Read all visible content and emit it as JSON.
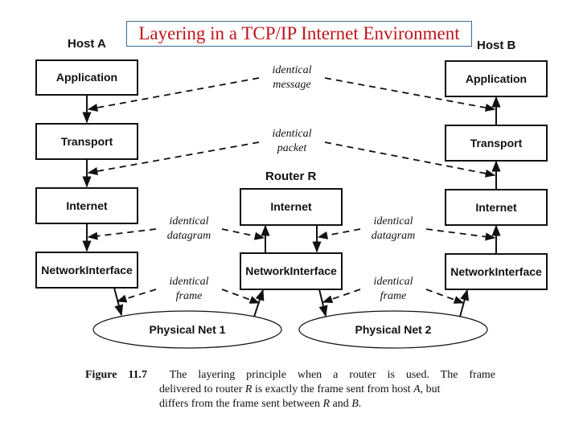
{
  "title": "Layering in a TCP/IP Internet Environment",
  "hosts": {
    "a": {
      "label": "Host A",
      "layers": [
        "Application",
        "Transport",
        "Internet",
        "Network Interface"
      ]
    },
    "router": {
      "label": "Router R",
      "layers": [
        "Internet",
        "Network Interface"
      ]
    },
    "b": {
      "label": "Host B",
      "layers": [
        "Application",
        "Transport",
        "Internet",
        "Network Interface"
      ]
    }
  },
  "annotations": {
    "message": [
      "identical",
      "message"
    ],
    "packet": [
      "identical",
      "packet"
    ],
    "datagram_left": [
      "identical",
      "datagram"
    ],
    "datagram_right": [
      "identical",
      "datagram"
    ],
    "frame_left": [
      "identical",
      "frame"
    ],
    "frame_right": [
      "identical",
      "frame"
    ]
  },
  "networks": [
    "Physical Net 1",
    "Physical Net 2"
  ],
  "caption": {
    "figure": "Figure 11.7",
    "line1": "The layering principle when a router is used. The frame",
    "line2_a": "delivered to router ",
    "line2_r": "R",
    "line2_b": " is exactly the frame sent from host ",
    "line2_h": "A",
    "line2_c": ", but",
    "line3_a": "differs from the frame sent between ",
    "line3_r": "R",
    "line3_b": " and ",
    "line3_h": "B",
    "line3_c": "."
  }
}
